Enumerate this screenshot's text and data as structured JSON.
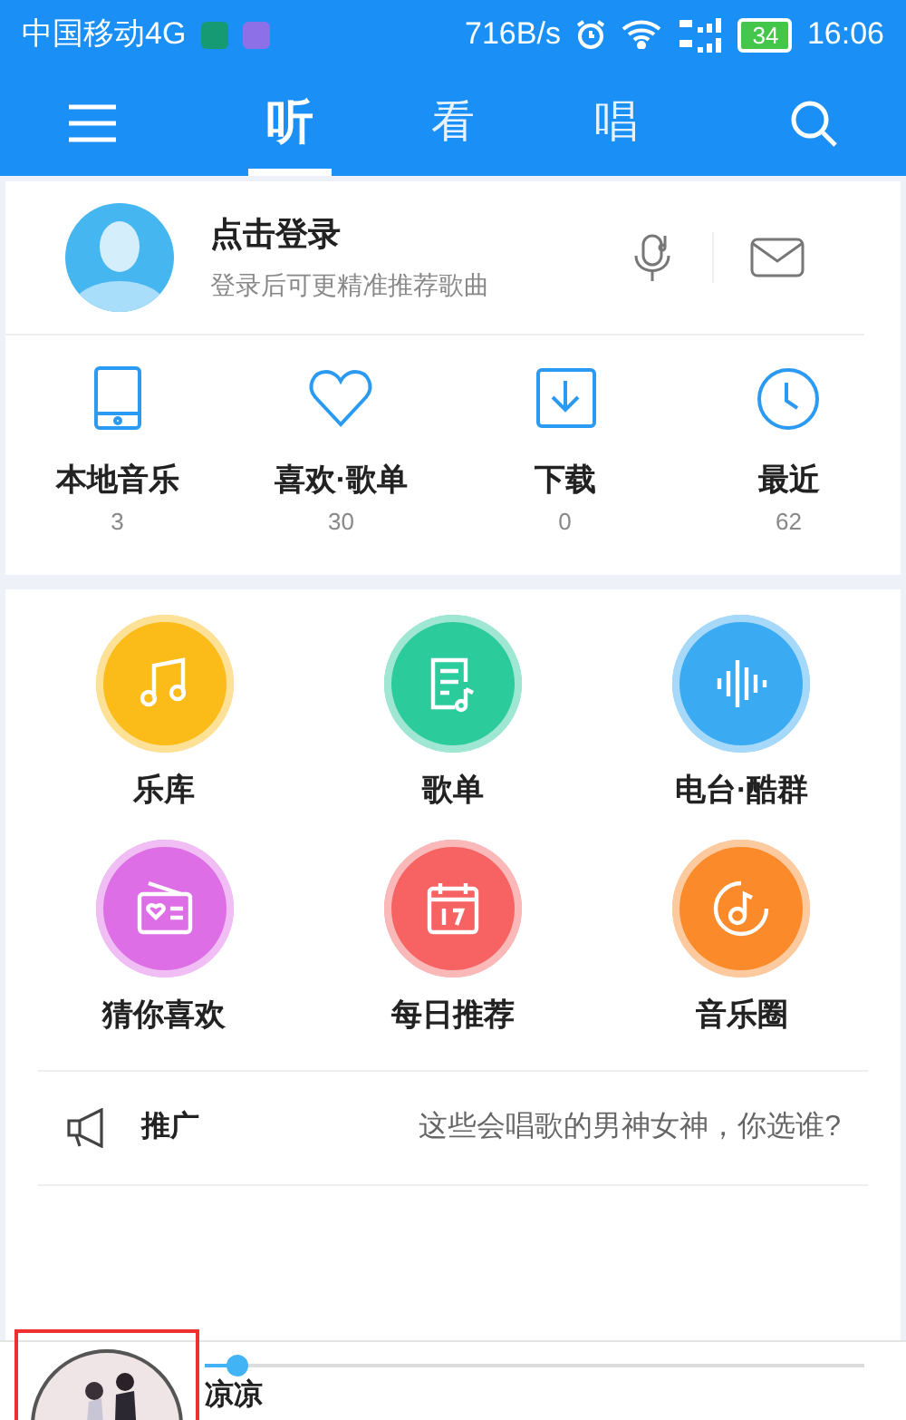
{
  "status_bar": {
    "carrier": "中国移动4G",
    "speed": "716B/s",
    "battery": "34",
    "time": "16:06"
  },
  "nav": {
    "tabs": [
      {
        "label": "听",
        "selected": true
      },
      {
        "label": "看",
        "selected": false
      },
      {
        "label": "唱",
        "selected": false
      }
    ]
  },
  "profile": {
    "title": "点击登录",
    "subtitle": "登录后可更精准推荐歌曲"
  },
  "shortcuts": [
    {
      "kind": "tablet",
      "label": "本地音乐",
      "count": "3"
    },
    {
      "kind": "heart",
      "label": "喜欢·歌单",
      "count": "30"
    },
    {
      "kind": "download",
      "label": "下载",
      "count": "0"
    },
    {
      "kind": "clock",
      "label": "最近",
      "count": "62"
    }
  ],
  "features": [
    {
      "kind": "music",
      "label": "乐库",
      "color": "#fbbc1a"
    },
    {
      "kind": "list",
      "label": "歌单",
      "color": "#2ccb9c"
    },
    {
      "kind": "wave",
      "label": "电台·酷群",
      "color": "#3aabf2"
    },
    {
      "kind": "radio",
      "label": "猜你喜欢",
      "color": "#de6ee6"
    },
    {
      "kind": "calendar",
      "label": "每日推荐",
      "color": "#f76262"
    },
    {
      "kind": "disc",
      "label": "音乐圈",
      "color": "#fb8a2a"
    }
  ],
  "promo": {
    "label": "推广",
    "text": "这些会唱歌的男神女神，你选谁?"
  },
  "player": {
    "level": 0.05,
    "song": "凉凉"
  }
}
